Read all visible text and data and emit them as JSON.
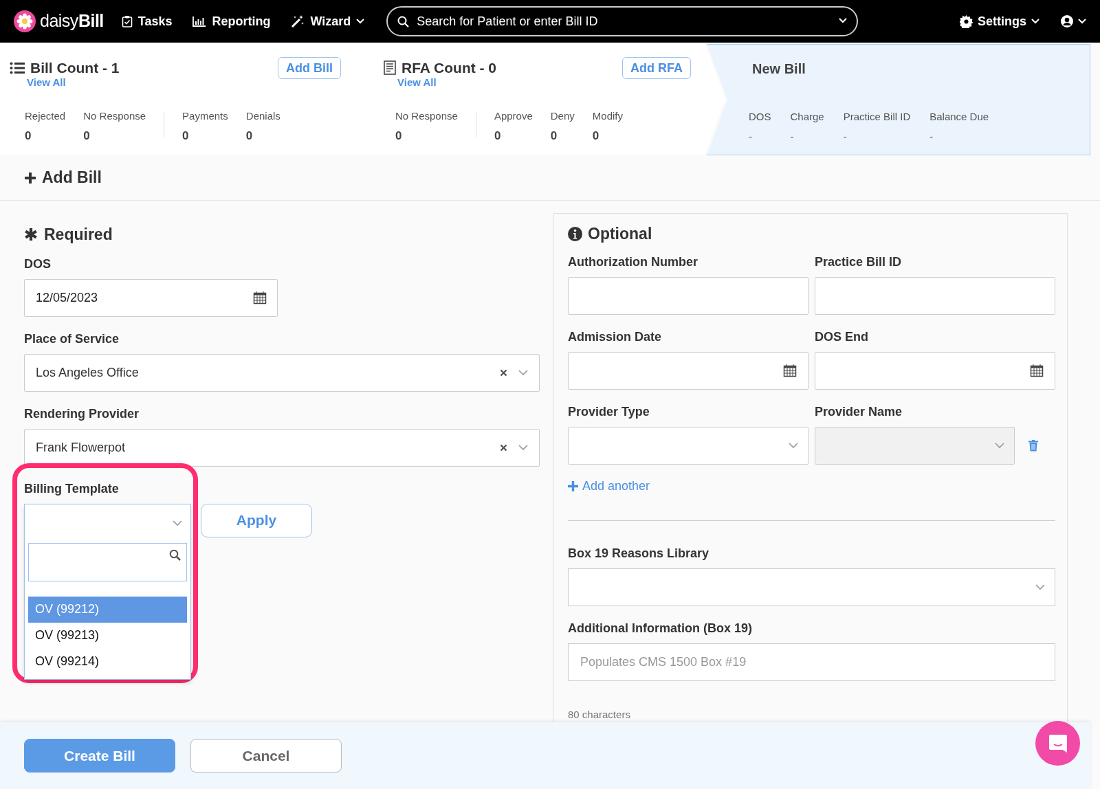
{
  "nav": {
    "logo": "daisy**Bill**",
    "items": [
      {
        "label": "Tasks",
        "kind": "tasks"
      },
      {
        "label": "Reporting",
        "kind": "reporting"
      },
      {
        "label": "Wizard",
        "kind": "wizard"
      }
    ],
    "search": {
      "placeholder": "Search for Patient or enter Bill ID"
    },
    "settings": "Settings"
  },
  "summary": {
    "segments": [
      {
        "title": "Bill Count - 1",
        "kind": "list",
        "link": "View All",
        "button": "Add Bill",
        "groups": [
          [
            {
              "label": "Rejected",
              "value": "0"
            },
            {
              "label": "No Response",
              "value": "0"
            }
          ],
          [
            {
              "label": "Payments",
              "value": "0"
            },
            {
              "label": "Denials",
              "value": "0"
            }
          ]
        ]
      },
      {
        "title": "RFA Count - 0",
        "kind": "doc",
        "link": "View All",
        "button": "Add RFA",
        "groups": [
          [
            {
              "label": "No Response",
              "value": "0"
            }
          ],
          [
            {
              "label": "Approve",
              "value": "0"
            },
            {
              "label": "Deny",
              "value": "0"
            },
            {
              "label": "Modify",
              "value": "0"
            }
          ]
        ]
      }
    ],
    "new_bill": {
      "title": "New Bill",
      "fields": [
        {
          "label": "DOS",
          "value": "-"
        },
        {
          "label": "Charge",
          "value": "-"
        },
        {
          "label": "Practice Bill ID",
          "value": "-"
        },
        {
          "label": "Balance Due",
          "value": "-"
        }
      ]
    }
  },
  "page_title": "Add Bill",
  "required": {
    "heading": "Required",
    "fields": [
      {
        "label": "DOS",
        "kind": "date",
        "value": "12/05/2023"
      },
      {
        "label": "Place of Service",
        "kind": "select",
        "value": "Los Angeles Office"
      },
      {
        "label": "Rendering Provider",
        "kind": "select",
        "value": "Frank Flowerpot"
      }
    ],
    "billing_template": {
      "label": "Billing Template",
      "highlighted": true,
      "apply": "Apply",
      "options": [
        {
          "label": "OV (99212)",
          "selected": true
        },
        {
          "label": "OV (99213)",
          "selected": false
        },
        {
          "label": "OV (99214)",
          "selected": false
        }
      ]
    }
  },
  "optional": {
    "heading": "Optional",
    "fields": [
      {
        "label": "Authorization Number",
        "kind": "text"
      },
      {
        "label": "Practice Bill ID",
        "kind": "text"
      },
      {
        "label": "Admission Date",
        "kind": "date"
      },
      {
        "label": "DOS End",
        "kind": "date"
      },
      {
        "label": "Provider Type",
        "kind": "select",
        "disabled": false
      },
      {
        "label": "Provider Name",
        "kind": "select",
        "disabled": true
      }
    ],
    "add_another": "Add another",
    "box19_library": {
      "label": "Box 19 Reasons Library"
    },
    "additional_info": {
      "label": "Additional Information (Box 19)",
      "placeholder": "Populates CMS 1500 Box #19"
    },
    "char_count": "80 characters"
  },
  "footer": {
    "buttons": [
      {
        "label": "Create Bill",
        "kind": "primary"
      },
      {
        "label": "Cancel",
        "kind": "secondary"
      }
    ]
  }
}
